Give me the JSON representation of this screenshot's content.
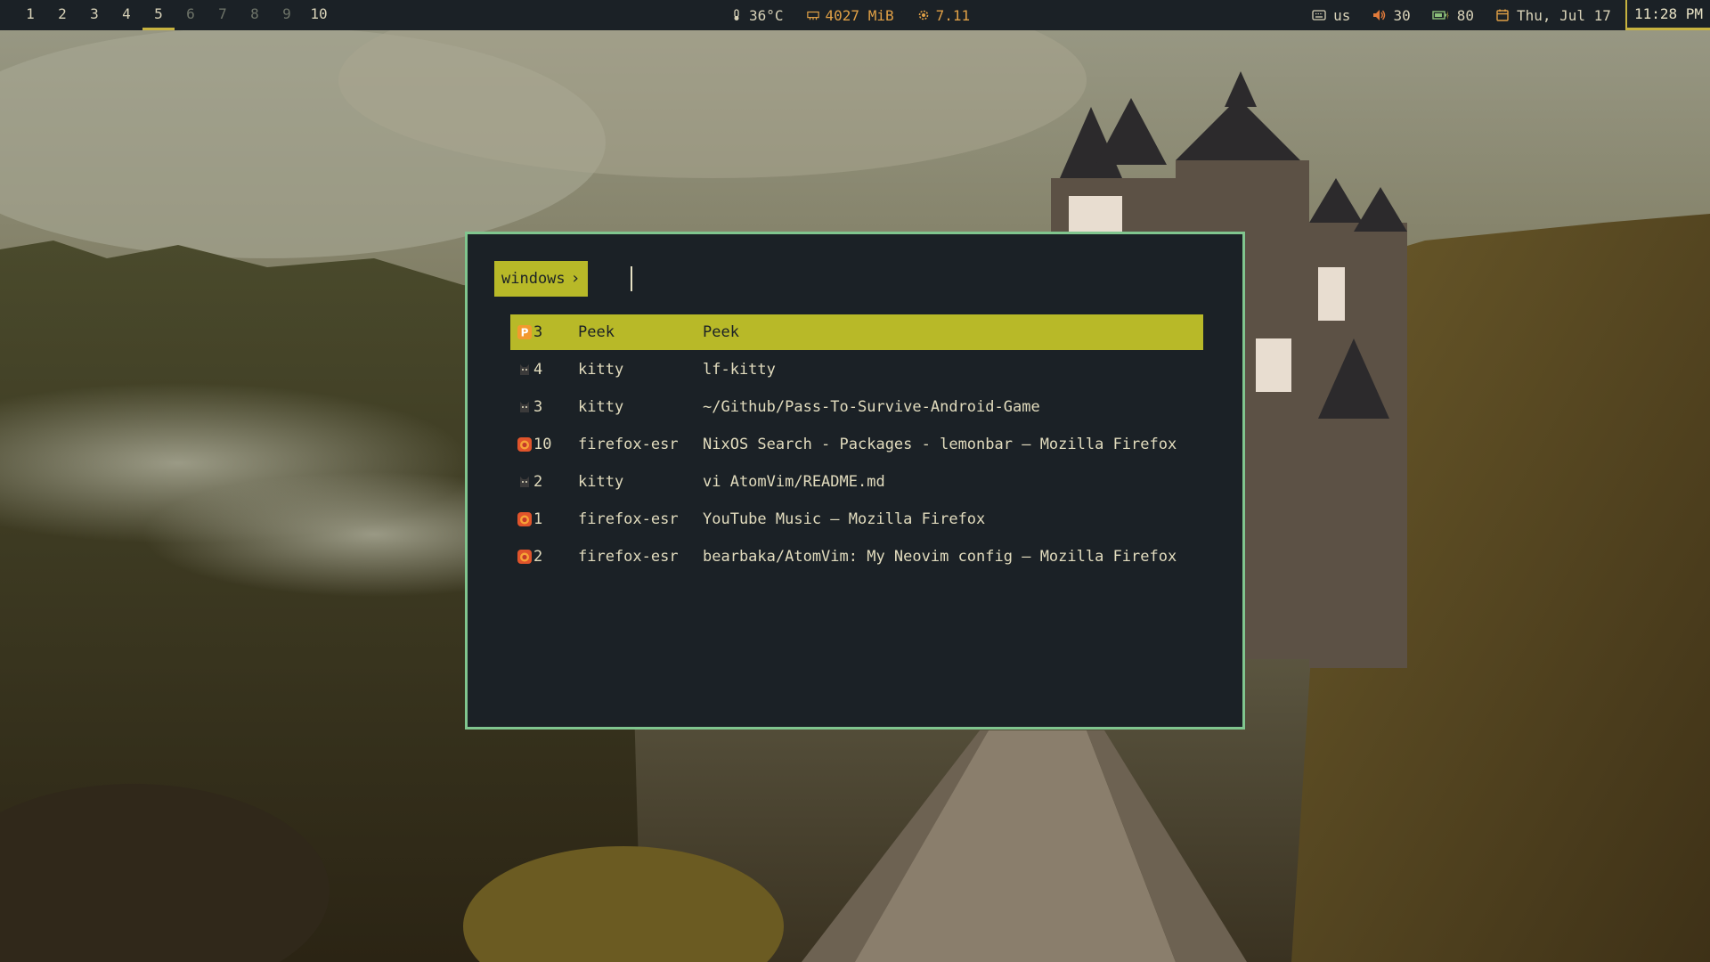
{
  "topbar": {
    "workspaces": [
      {
        "label": "1",
        "state": "occupied"
      },
      {
        "label": "2",
        "state": "occupied"
      },
      {
        "label": "3",
        "state": "occupied"
      },
      {
        "label": "4",
        "state": "occupied"
      },
      {
        "label": "5",
        "state": "active"
      },
      {
        "label": "6",
        "state": "empty"
      },
      {
        "label": "7",
        "state": "empty"
      },
      {
        "label": "8",
        "state": "empty"
      },
      {
        "label": "9",
        "state": "empty"
      },
      {
        "label": "10",
        "state": "occupied"
      }
    ],
    "temperature": "36°C",
    "memory": "4027 MiB",
    "cpu_load": "7.11",
    "keyboard_layout": "us",
    "volume": "30",
    "battery": "80",
    "date": "Thu, Jul 17",
    "time": "11:28 PM"
  },
  "launcher": {
    "prompt_label": "windows",
    "query": "",
    "results": [
      {
        "icon": "peek-icon",
        "workspace": "3",
        "class": "Peek",
        "title": "Peek",
        "selected": true
      },
      {
        "icon": "kitty-icon",
        "workspace": "4",
        "class": "kitty",
        "title": "lf-kitty",
        "selected": false
      },
      {
        "icon": "kitty-icon",
        "workspace": "3",
        "class": "kitty",
        "title": "~/Github/Pass-To-Survive-Android-Game",
        "selected": false
      },
      {
        "icon": "firefox-icon",
        "workspace": "10",
        "class": "firefox-esr",
        "title": "NixOS Search - Packages - lemonbar — Mozilla Firefox",
        "selected": false
      },
      {
        "icon": "kitty-icon",
        "workspace": "2",
        "class": "kitty",
        "title": "vi AtomVim/README.md",
        "selected": false
      },
      {
        "icon": "firefox-icon",
        "workspace": "1",
        "class": "firefox-esr",
        "title": "YouTube Music — Mozilla Firefox",
        "selected": false
      },
      {
        "icon": "firefox-icon",
        "workspace": "2",
        "class": "firefox-esr",
        "title": "bearbaka/AtomVim: My Neovim config — Mozilla Firefox",
        "selected": false
      }
    ]
  },
  "colors": {
    "bar_bg": "#1b2126",
    "accent": "#b8b928",
    "launcher_border": "#80c58e",
    "warning": "#e0a046"
  }
}
